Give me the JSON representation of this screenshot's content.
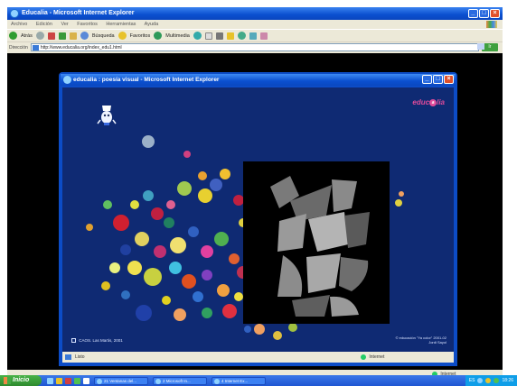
{
  "outer_window": {
    "title": "Educalia - Microsoft Internet Explorer",
    "menu": [
      "Archivo",
      "Edición",
      "Ver",
      "Favoritos",
      "Herramientas",
      "Ayuda"
    ],
    "toolbar": {
      "back": "Atrás",
      "search": "Búsqueda",
      "favorites": "Favoritos",
      "media": "Multimedia"
    },
    "address_label": "Dirección",
    "address_value": "http://www.educalia.org/index_edu1.html",
    "go_label": "Ir",
    "status_zone": "Internet"
  },
  "popup": {
    "title": "educalia : poesía visual - Microsoft Internet Explorer",
    "logo_prefix": "educ",
    "logo_o": "a",
    "logo_suffix": "lia",
    "credit_left": "CAOS. Las Martis, 2001",
    "credit_right": "© educación \"Ya color\" 2001-02 Jordi Sayol",
    "status_left": "Listo",
    "status_zone": "Internet"
  },
  "taskbar": {
    "start_label": "Inicio",
    "tasks": [
      "21 Ventanas del...",
      "2 Microsoft In...",
      "4 Internet Ex..."
    ],
    "lang": "ES",
    "clock": "18:26"
  },
  "colors": {
    "stage_bg": "#0f2a73",
    "xp_blue": "#0a4fcf",
    "logo_pink": "#e04b9a"
  }
}
